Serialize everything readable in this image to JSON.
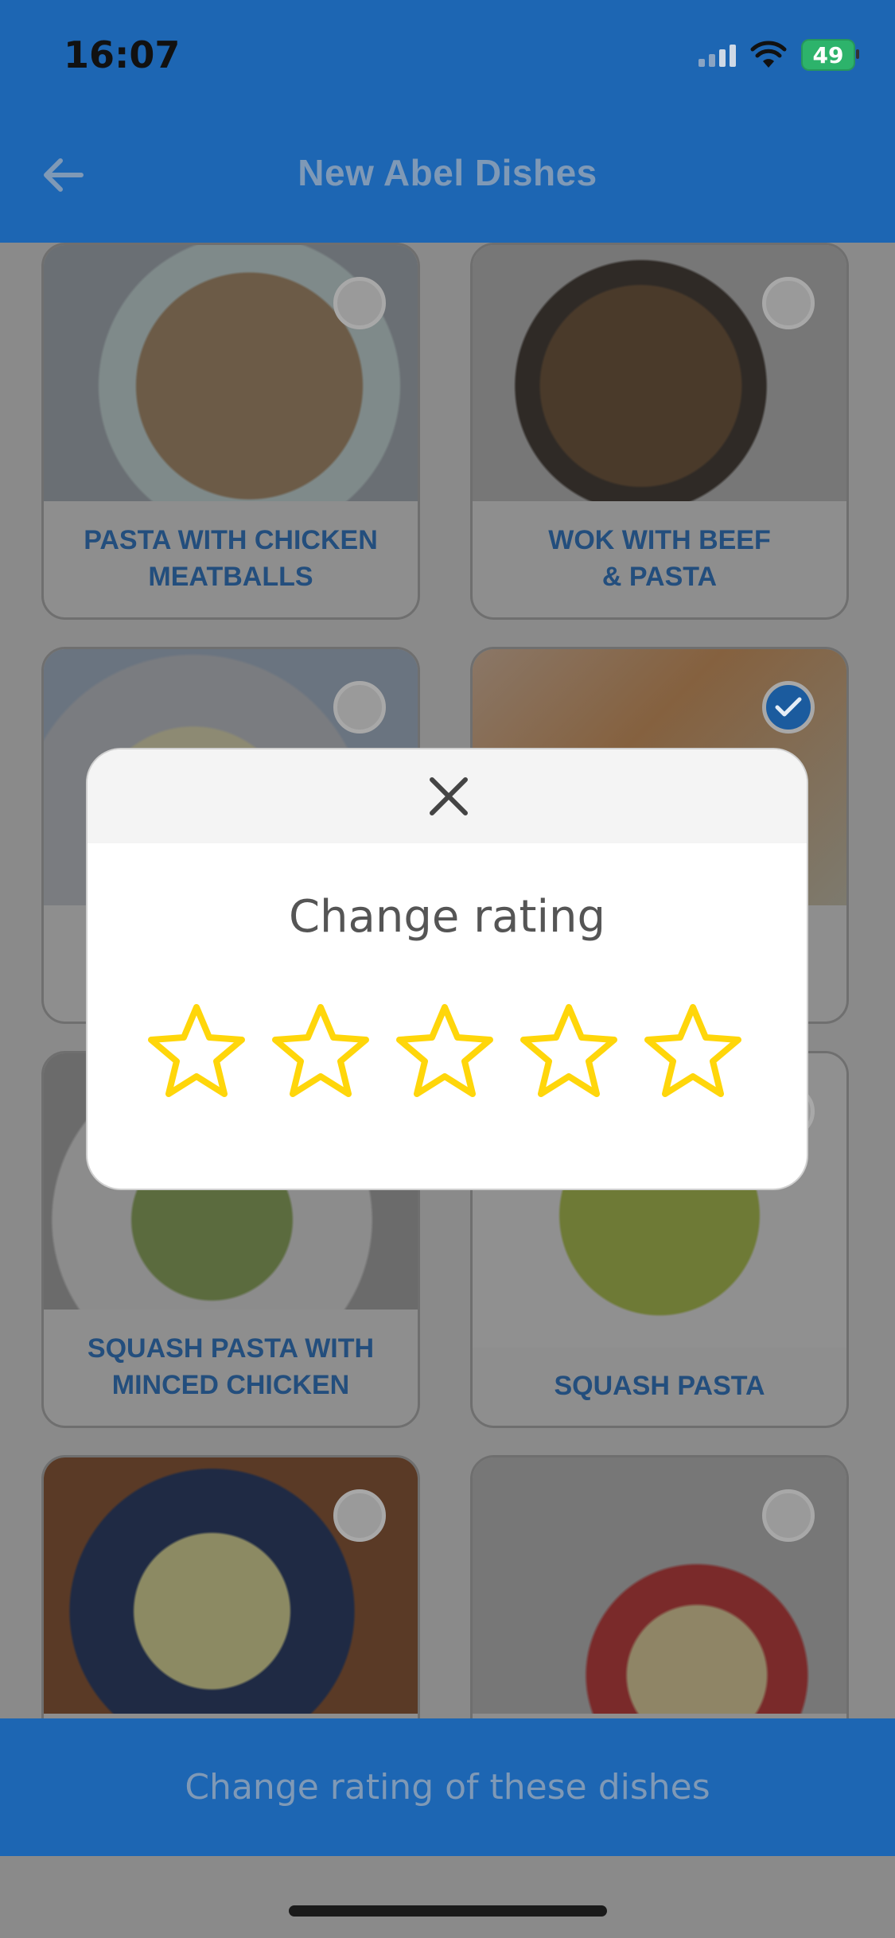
{
  "status": {
    "time": "16:07",
    "battery": "49"
  },
  "header": {
    "title": "New Abel Dishes"
  },
  "dishes": [
    {
      "label_line1": "PASTA WITH CHICKEN",
      "label_line2": "MEATBALLS",
      "selected": false
    },
    {
      "label_line1": "WOK WITH BEEF",
      "label_line2": "& PASTA",
      "selected": false
    },
    {
      "label_line1": "",
      "label_line2": "",
      "selected": false
    },
    {
      "label_line1": "",
      "label_line2": "...",
      "selected": true
    },
    {
      "label_line1": "SQUASH PASTA WITH",
      "label_line2": "MINCED CHICKEN",
      "selected": false
    },
    {
      "label_line1": "SQUASH PASTA",
      "label_line2": "",
      "selected": false
    },
    {
      "label_line1": "",
      "label_line2": "",
      "selected": false
    },
    {
      "label_line1": "",
      "label_line2": "",
      "selected": false
    }
  ],
  "modal": {
    "title": "Change rating",
    "stars": 5,
    "star_color": "#FFD60A"
  },
  "footer": {
    "button_label": "Change rating of these dishes"
  },
  "colors": {
    "brand_blue": "#1d66b3",
    "label_blue": "#234e7d"
  }
}
